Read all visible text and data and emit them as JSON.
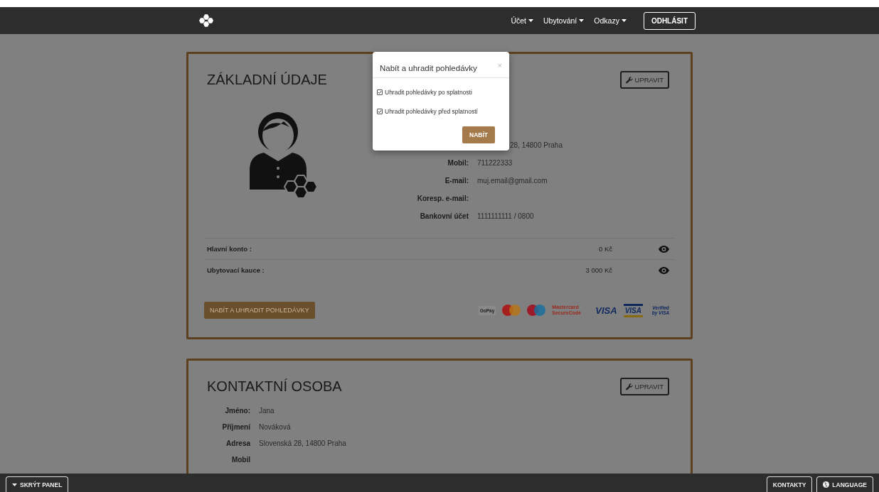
{
  "header": {
    "nav": [
      {
        "label": "Účet"
      },
      {
        "label": "Ubytování"
      },
      {
        "label": "Odkazy"
      }
    ],
    "logout": "ODHLÁSIT"
  },
  "basic_card": {
    "title": "ZÁKLADNÍ ÚDAJE",
    "edit_button": "UPRAVIT",
    "fields": [
      {
        "value": "28, 14800 Praha",
        "kind": "partly_covered"
      },
      {
        "label": "Mobil:",
        "value": "711222333"
      },
      {
        "label": "E-mail:",
        "value": "muj.email@gmail.com"
      },
      {
        "label": "Koresp. e-mail:"
      },
      {
        "label": "Bankovní účet",
        "value": "1111111111 / 0800"
      }
    ],
    "balances": [
      {
        "label": "Hlavní konto :",
        "amount": "0 Kč"
      },
      {
        "label": "Ubytovací kauce :",
        "amount": "3 000 Kč"
      }
    ],
    "charge_button": "NABÍT A UHRADIT POHLEDÁVKY",
    "payment_logos": [
      {
        "kind": "gopay",
        "text": "GoPay"
      },
      {
        "kind": "mastercard"
      },
      {
        "kind": "maestro"
      },
      {
        "kind": "securecode",
        "text": "Mastercard SecureCode"
      },
      {
        "kind": "visa",
        "text": "VISA"
      },
      {
        "kind": "visa_card",
        "text": "VISA"
      },
      {
        "kind": "verified",
        "text": "Verified by VISA"
      }
    ]
  },
  "contact_card": {
    "title": "KONTAKTNÍ OSOBA",
    "edit_button": "UPRAVIT",
    "fields": [
      {
        "label": "Jméno:",
        "value": "Jana"
      },
      {
        "label": "Příjmení",
        "value": "Nováková"
      },
      {
        "label": "Adresa",
        "value": "Slovenská 28, 14800 Praha"
      },
      {
        "label": "Mobil"
      }
    ]
  },
  "modal": {
    "title": "Nabít a uhradit pohledávky",
    "close": "×",
    "options": [
      {
        "label": "Uhradit pohledávky po splatnosti",
        "checked": true
      },
      {
        "label": "Uhradit pohledávky před splatností",
        "checked": true
      }
    ],
    "button": "NABÍT"
  },
  "footer": {
    "hide_panel": "SKRÝT PANEL",
    "contacts": "KONTAKTY",
    "language": "LANGUAGE"
  }
}
